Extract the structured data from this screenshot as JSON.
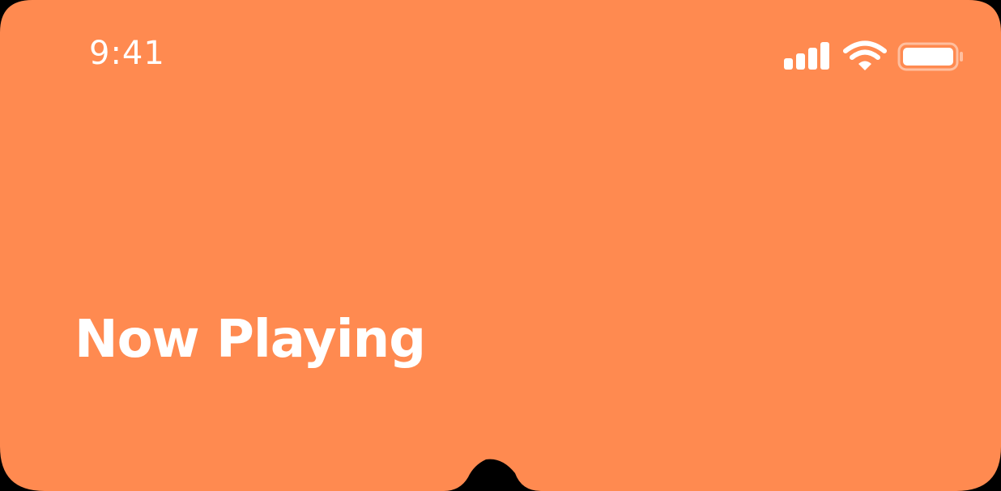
{
  "status_bar": {
    "time": "9:41",
    "icons": [
      "signal-icon",
      "wifi-icon",
      "battery-icon"
    ]
  },
  "header": {
    "title": "Now Playing"
  },
  "colors": {
    "background": "#FF8A50",
    "text": "#FFFFFF"
  }
}
